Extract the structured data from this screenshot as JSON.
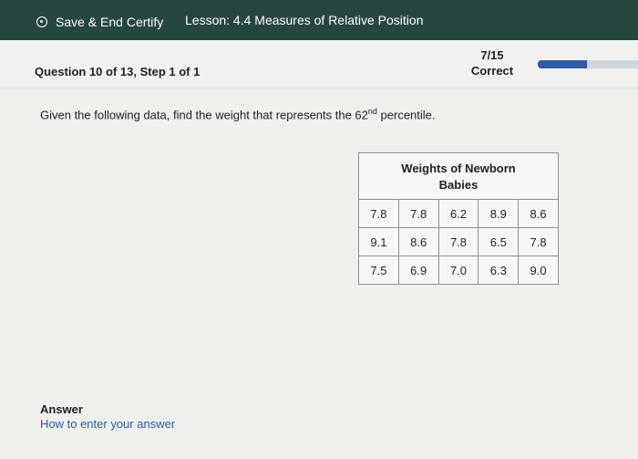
{
  "header": {
    "save_label": "Save & End Certify",
    "lesson_title": "Lesson: 4.4 Measures of Relative Position"
  },
  "question": {
    "title": "Question 10 of 13, Step 1 of 1",
    "score": "7/15",
    "status": "Correct",
    "progress": 0.45
  },
  "prompt": {
    "before": "Given the following data, find the weight that represents the 62",
    "sup": "nd",
    "after": " percentile."
  },
  "table": {
    "title_line1": "Weights of Newborn",
    "title_line2": "Babies",
    "rows": [
      [
        "7.8",
        "7.8",
        "6.2",
        "8.9",
        "8.6"
      ],
      [
        "9.1",
        "8.6",
        "7.8",
        "6.5",
        "7.8"
      ],
      [
        "7.5",
        "6.9",
        "7.0",
        "6.3",
        "9.0"
      ]
    ]
  },
  "answer": {
    "label": "Answer",
    "help_link": "How to enter your answer"
  },
  "colors": {
    "header_bg": "#26473f",
    "accent": "#2b5aa8"
  }
}
